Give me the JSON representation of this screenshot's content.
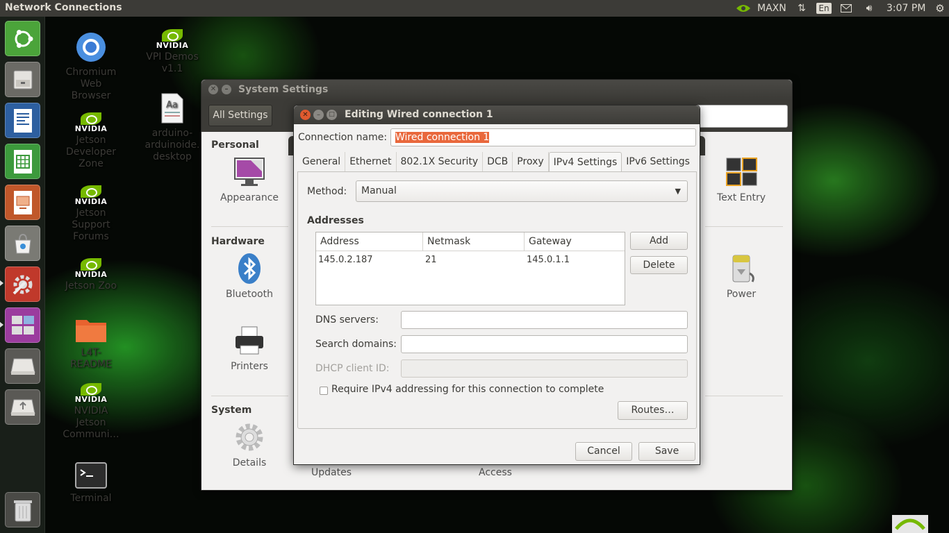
{
  "top_panel": {
    "title": "Network Connections",
    "indicator_maxn": "MAXN",
    "keyboard_layout": "En",
    "clock": "3:07 PM"
  },
  "launcher": {
    "items": [
      "ubuntu-dash",
      "files",
      "libreoffice-writer",
      "libreoffice-calc",
      "libreoffice-impress",
      "ubuntu-software",
      "system-settings",
      "workspaces",
      "drive",
      "usb-drive",
      "trash"
    ]
  },
  "desktop_icons": [
    {
      "lines": [
        "Chromium",
        "Web",
        "Browser"
      ]
    },
    {
      "lines": [
        "VPI Demos",
        "v1.1"
      ]
    },
    {
      "lines": [
        "Jetson",
        "Developer",
        "Zone"
      ]
    },
    {
      "lines": [
        "arduino-",
        "arduinoide.",
        "desktop"
      ]
    },
    {
      "lines": [
        "Jetson",
        "Support",
        "Forums"
      ]
    },
    {
      "lines": [
        "Jetson Zoo"
      ]
    },
    {
      "lines": [
        "L4T-",
        "README"
      ]
    },
    {
      "lines": [
        "NVIDIA",
        "Jetson",
        "Communi…"
      ]
    },
    {
      "lines": [
        "Terminal"
      ]
    }
  ],
  "system_settings": {
    "title": "System Settings",
    "all_settings": "All Settings",
    "sections": {
      "personal": "Personal",
      "hardware": "Hardware",
      "system": "System"
    },
    "items": {
      "appearance": "Appearance",
      "text_entry": "Text Entry",
      "bluetooth": "Bluetooth",
      "power": "Power",
      "printers": "Printers",
      "details": "Details",
      "updates": "Updates",
      "access": "Access"
    }
  },
  "dialog": {
    "title": "Editing Wired connection 1",
    "connection_name_label": "Connection name:",
    "connection_name_value": "Wired connection 1",
    "tabs": [
      "General",
      "Ethernet",
      "802.1X Security",
      "DCB",
      "Proxy",
      "IPv4 Settings",
      "IPv6 Settings"
    ],
    "active_tab": "IPv4 Settings",
    "method_label": "Method:",
    "method_value": "Manual",
    "addresses_heading": "Addresses",
    "columns": [
      "Address",
      "Netmask",
      "Gateway"
    ],
    "rows": [
      {
        "address": "145.0.2.187",
        "netmask": "21",
        "gateway": "145.0.1.1"
      }
    ],
    "add_button": "Add",
    "delete_button": "Delete",
    "dns_label": "DNS servers:",
    "dns_value": "",
    "search_label": "Search domains:",
    "search_value": "",
    "dhcp_label": "DHCP client ID:",
    "dhcp_value": "",
    "require_ipv4_label": "Require IPv4 addressing for this connection to complete",
    "require_ipv4_checked": false,
    "routes_button": "Routes…",
    "cancel_button": "Cancel",
    "save_button": "Save"
  },
  "colors": {
    "panel": "#3c3b37",
    "selection": "#e9683c",
    "close_button": "#e05a2f",
    "nvidia_green": "#76b900"
  }
}
